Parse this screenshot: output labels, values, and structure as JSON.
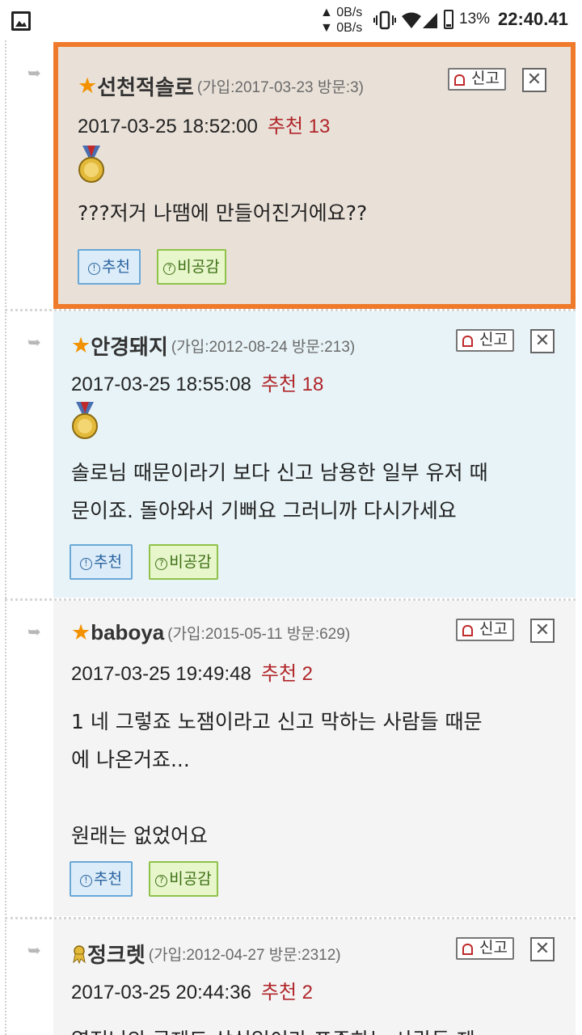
{
  "status_bar": {
    "net_up": "▲ 0B/s",
    "net_down": "▼ 0B/s",
    "battery_percent": "13%",
    "time": "22:40.41"
  },
  "comments": [
    {
      "star": "★",
      "nickname": "선천적솔로",
      "meta": "(가입:2017-03-23 방문:3)",
      "datetime": "2017-03-25 18:52:00",
      "recommend": "추천 13",
      "body_lines": [
        "???저거 나땜에 만들어진거에요??"
      ],
      "highlighted": true,
      "bg": "#e9e1d8"
    },
    {
      "star": "★",
      "nickname": "안경돼지",
      "meta": "(가입:2012-08-24 방문:213)",
      "datetime": "2017-03-25 18:55:08",
      "recommend": "추천 18",
      "body_lines": [
        "솔로님 때문이라기 보다 신고 남용한 일부 유저 때",
        "문이죠. 돌아와서 기뻐요 그러니까 다시가세요"
      ],
      "highlighted": false,
      "bg": "#e7f3f7"
    },
    {
      "star": "★",
      "nickname": "baboya",
      "meta": "(가입:2015-05-11 방문:629)",
      "datetime": "2017-03-25 19:49:48",
      "recommend": "추천 2",
      "body_lines": [
        "1 네 그렇죠 노잼이라고 신고 막하는 사람들 때문",
        "에 나온거죠...",
        "",
        "원래는 없었어요"
      ],
      "highlighted": false,
      "bg": "#f4f4f4"
    },
    {
      "star": "",
      "nickname": "정크렛",
      "meta": "(가입:2012-04-27 방문:2312)",
      "datetime": "2017-03-25 20:44:36",
      "recommend": "추천 2",
      "body_lines": [
        "열정님의 글제도 삼십일이라 표준하는 사람들 제"
      ],
      "highlighted": false,
      "bg": "#f4f4f4"
    }
  ],
  "labels": {
    "report": "신고",
    "close": "✕",
    "upvote": "추천",
    "upvote_mark": "!",
    "downvote": "비공감",
    "downvote_mark": "?",
    "reply_arrow": "➥"
  },
  "colors": {
    "highlight_border": "#f07a2c",
    "star": "#f39200",
    "recommend": "#b0262a"
  },
  "icons": [
    "gallery-icon",
    "vibrate-icon",
    "wifi-icon",
    "signal-icon",
    "battery-icon",
    "siren-icon",
    "close-icon",
    "medal-icon",
    "reply-arrow-icon",
    "rank-badge-icon"
  ]
}
